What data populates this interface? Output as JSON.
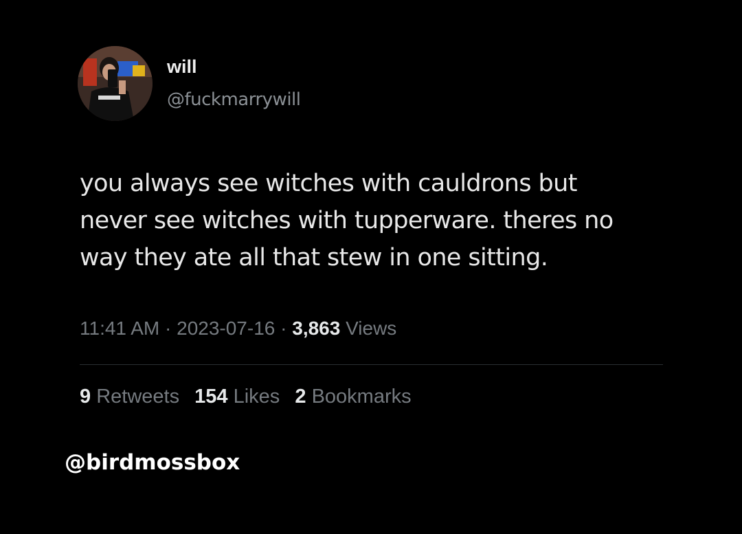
{
  "user": {
    "display_name": "will",
    "handle": "@fuckmarrywill",
    "avatar_icon": "profile-photo-icon"
  },
  "tweet": {
    "lines": [
      "you always see witches with cauldrons but",
      "never see witches with tupperware. theres no",
      "way they ate all that stew in one sitting."
    ]
  },
  "meta": {
    "time": "11:41 AM",
    "separator": "·",
    "date": "2023-07-16",
    "views_count": "3,863",
    "views_label": "Views"
  },
  "stats": {
    "retweets_count": "9",
    "retweets_label": "Retweets",
    "likes_count": "154",
    "likes_label": "Likes",
    "bookmarks_count": "2",
    "bookmarks_label": "Bookmarks"
  },
  "watermark": "@birdmossbox",
  "colors": {
    "background": "#000000",
    "text_primary": "#e7e9ea",
    "text_secondary": "#767b80"
  }
}
